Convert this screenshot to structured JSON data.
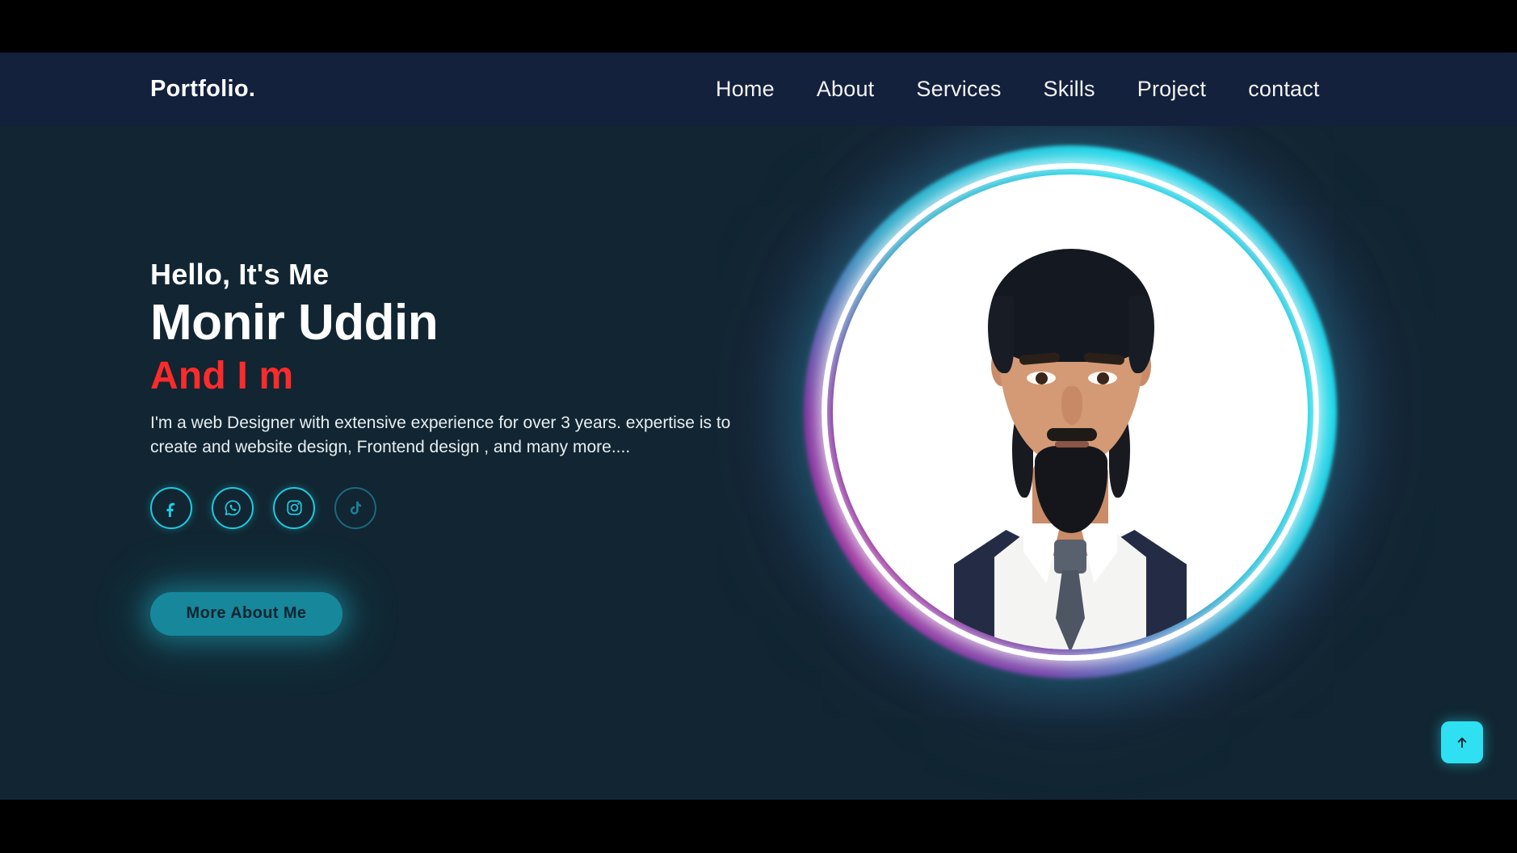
{
  "header": {
    "logo": "Portfolio.",
    "nav": [
      {
        "label": "Home"
      },
      {
        "label": "About"
      },
      {
        "label": "Services"
      },
      {
        "label": "Skills"
      },
      {
        "label": "Project"
      },
      {
        "label": "contact"
      }
    ]
  },
  "hero": {
    "greeting": "Hello, It's Me",
    "name": "Monir Uddin",
    "role_line": "And I m",
    "bio": "I'm a web Designer with extensive experience for over 3 years. expertise is to create and website design, Frontend design , and many more....",
    "cta_label": "More About Me",
    "socials": [
      {
        "name": "facebook",
        "label": "Facebook"
      },
      {
        "name": "whatsapp",
        "label": "WhatsApp"
      },
      {
        "name": "instagram",
        "label": "Instagram"
      },
      {
        "name": "tiktok",
        "label": "TikTok"
      }
    ],
    "portrait_alt": "Monir Uddin portrait"
  },
  "scroll_top": {
    "label": "Scroll to top",
    "icon": "arrow-up-icon"
  },
  "colors": {
    "header_bg": "#14213D",
    "page_bg": "#112632",
    "accent_cyan": "#2EE0F2",
    "accent_red": "#FF2B2B",
    "cta_bg": "#17879C",
    "ring_purple": "#9C2F9C",
    "text_light": "#FFFFFF"
  }
}
